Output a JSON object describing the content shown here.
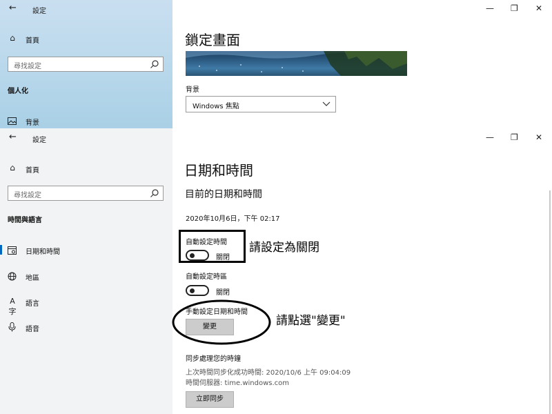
{
  "top_window": {
    "title": "設定",
    "nav_home": "首頁",
    "search_placeholder": "尋找設定",
    "category": "個人化",
    "nav_background": "背景",
    "page_title": "鎖定畫面",
    "background_label": "背景",
    "background_select_value": "Windows 焦點"
  },
  "main_window": {
    "title": "設定",
    "nav_home": "首頁",
    "search_placeholder": "尋找設定",
    "category": "時間與語言",
    "nav_items": [
      {
        "label": "日期和時間",
        "icon": "calendar-icon"
      },
      {
        "label": "地區",
        "icon": "globe-icon"
      },
      {
        "label": "語言",
        "icon": "language-icon"
      },
      {
        "label": "語音",
        "icon": "microphone-icon"
      }
    ],
    "page_title": "日期和時間",
    "section_title": "目前的日期和時間",
    "current_datetime": "2020年10月6日，下午 02:17",
    "auto_time_label": "自動設定時間",
    "auto_time_state": "關閉",
    "auto_timezone_label": "自動設定時區",
    "auto_timezone_state": "關閉",
    "manual_label": "手動設定日期和時間",
    "change_button": "變更",
    "sync_title": "同步處理您的時鐘",
    "last_sync": "上次時間同步化成功時間: 2020/10/6 上午 09:04:09",
    "time_server": "時間伺服器: time.windows.com",
    "sync_button": "立即同步"
  },
  "annotations": {
    "note_toggle": "請設定為關閉",
    "note_change": "請點選\"變更\""
  },
  "window_controls": {
    "minimize": "—",
    "restore": "❐",
    "close": "✕"
  },
  "colors": {
    "accent": "#0067c0",
    "button_bg": "#cccccc",
    "sidebar_top": "#bcd9ec",
    "sidebar_bottom": "#f1f3f5"
  }
}
